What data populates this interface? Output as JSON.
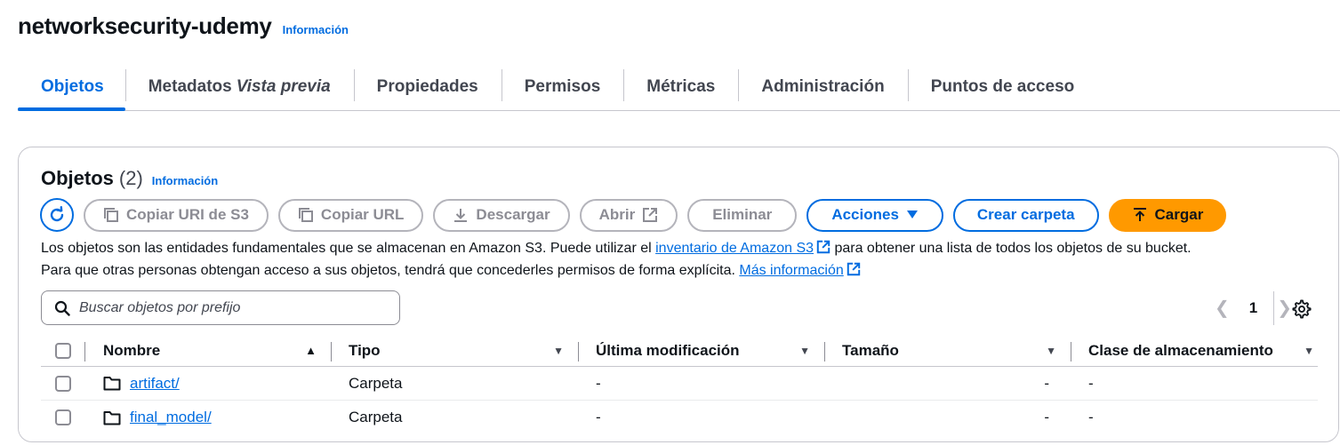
{
  "bucket": {
    "title": "networksecurity-udemy",
    "info_label": "Información"
  },
  "tabs": [
    {
      "label": "Objetos",
      "suffix": ""
    },
    {
      "label": "Metadatos",
      "suffix": "Vista previa"
    },
    {
      "label": "Propiedades",
      "suffix": ""
    },
    {
      "label": "Permisos",
      "suffix": ""
    },
    {
      "label": "Métricas",
      "suffix": ""
    },
    {
      "label": "Administración",
      "suffix": ""
    },
    {
      "label": "Puntos de acceso",
      "suffix": ""
    }
  ],
  "panel": {
    "title": "Objetos",
    "count": "(2)",
    "info_label": "Información"
  },
  "toolbar": {
    "copy_uri": "Copiar URI de S3",
    "copy_url": "Copiar URL",
    "download": "Descargar",
    "open": "Abrir",
    "delete": "Eliminar",
    "actions": "Acciones",
    "create_folder": "Crear carpeta",
    "upload": "Cargar"
  },
  "description": {
    "line1_pre": "Los objetos son las entidades fundamentales que se almacenan en Amazon S3. Puede utilizar el ",
    "line1_link": "inventario de Amazon S3",
    "line1_post": " para obtener una lista de todos los objetos de su bucket.",
    "line2_pre": "Para que otras personas obtengan acceso a sus objetos, tendrá que concederles permisos de forma explícita. ",
    "line2_link": "Más información"
  },
  "search": {
    "placeholder": "Buscar objetos por prefijo",
    "value": ""
  },
  "pagination": {
    "current_page": "1"
  },
  "table": {
    "headers": {
      "name": "Nombre",
      "type": "Tipo",
      "modified": "Última modificación",
      "size": "Tamaño",
      "storage_class": "Clase de almacenamiento"
    },
    "rows": [
      {
        "name": "artifact/",
        "type": "Carpeta",
        "modified": "-",
        "size": "-",
        "storage_class": "-"
      },
      {
        "name": "final_model/",
        "type": "Carpeta",
        "modified": "-",
        "size": "-",
        "storage_class": "-"
      }
    ]
  },
  "colors": {
    "accent": "#006ce0",
    "upload_button": "#ff9900",
    "disabled": "#8c8c94",
    "border": "#c6c6cd"
  },
  "icons": {
    "refresh": "refresh-icon",
    "copy": "copy-icon",
    "download": "download-icon",
    "external": "external-link-icon",
    "caret": "caret-down-icon",
    "upload": "upload-icon",
    "search": "search-icon",
    "settings": "gear-icon",
    "folder": "folder-icon"
  }
}
